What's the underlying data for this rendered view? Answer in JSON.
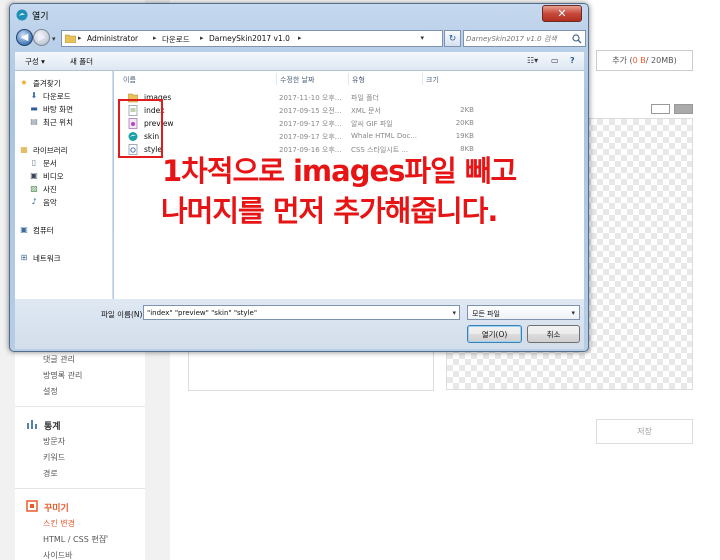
{
  "background": {
    "sidebar": {
      "links_top": [
        "댓글 관리",
        "방명록 관리",
        "설정"
      ],
      "section_stats": {
        "title": "통계",
        "links": [
          "방문자",
          "키워드",
          "경로"
        ]
      },
      "section_decor": {
        "title": "꾸미기",
        "links": [
          "스킨 변경",
          "HTML / CSS 편집",
          "사이드바"
        ]
      }
    },
    "add_button": {
      "prefix": "추가 (",
      "size": "0 B",
      "suffix": " / 20MB)"
    },
    "save_button": "저장"
  },
  "dialog": {
    "title": "열기",
    "close_label": "✕",
    "breadcrumb": [
      "Administrator",
      "다운로드",
      "DarneySkin2017 v1.0"
    ],
    "search_placeholder": "DarneySkin2017 v1.0 검색",
    "toolbar": {
      "organize": "구성 ▾",
      "new_folder": "새 폴더"
    },
    "nav": [
      {
        "label": "즐겨찾기",
        "icon": "star-icon"
      },
      {
        "label": "다운로드",
        "icon": "download-folder-icon"
      },
      {
        "label": "바탕 화면",
        "icon": "desktop-icon"
      },
      {
        "label": "최근 위치",
        "icon": "recent-places-icon"
      },
      {
        "label": "라이브러리",
        "icon": "library-icon"
      },
      {
        "label": "문서",
        "icon": "document-icon"
      },
      {
        "label": "비디오",
        "icon": "video-icon"
      },
      {
        "label": "사진",
        "icon": "picture-icon"
      },
      {
        "label": "음악",
        "icon": "music-icon"
      },
      {
        "label": "컴퓨터",
        "icon": "computer-icon"
      },
      {
        "label": "네트워크",
        "icon": "network-icon"
      }
    ],
    "columns": [
      "이름",
      "수정한 날짜",
      "유형",
      "크기"
    ],
    "files": [
      {
        "name": "images",
        "date": "2017-11-10 오후...",
        "type": "파일 폴더",
        "size": "",
        "icon": "folder-icon"
      },
      {
        "name": "index",
        "date": "2017-09-15 오전...",
        "type": "XML 문서",
        "size": "2KB",
        "icon": "xml-file-icon"
      },
      {
        "name": "preview",
        "date": "2017-09-17 오후...",
        "type": "알씨 GIF 파일",
        "size": "20KB",
        "icon": "gif-file-icon"
      },
      {
        "name": "skin",
        "date": "2017-09-17 오후...",
        "type": "Whale HTML Doc...",
        "size": "19KB",
        "icon": "html-file-icon"
      },
      {
        "name": "style",
        "date": "2017-09-16 오후...",
        "type": "CSS 스타일시트 ...",
        "size": "8KB",
        "icon": "css-file-icon"
      }
    ],
    "filename_label": "파일 이름(N):",
    "filename_value": "\"index\" \"preview\" \"skin\" \"style\"",
    "filetype_value": "모든 파일",
    "open_button": "열기(O)",
    "cancel_button": "취소"
  },
  "annotation": {
    "line1": "1차적으로 images파일 빼고",
    "line2": "나머지를 먼저 추가해줍니다.",
    "color": "#e61414"
  }
}
